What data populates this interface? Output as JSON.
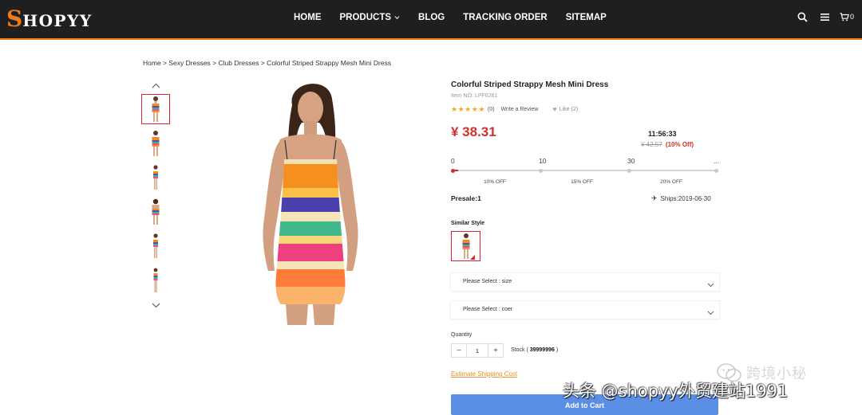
{
  "header": {
    "logo_first": "S",
    "logo_rest": "HOPYY",
    "nav": [
      {
        "label": "HOME"
      },
      {
        "label": "PRODUCTS",
        "has_caret": true
      },
      {
        "label": "BLOG"
      },
      {
        "label": "TRACKING ORDER"
      },
      {
        "label": "SITEMAP"
      }
    ],
    "icons": [
      "search-icon",
      "menu-icon",
      "cart-icon"
    ],
    "cart_count": "0",
    "accent_color": "#f07b1d",
    "bg_color": "#1f1f1f"
  },
  "breadcrumb": "Home > Sexy Dresses > Club Dresses > Colorful Striped Strappy Mesh Mini Dress",
  "gallery": {
    "thumb_count": 6,
    "active_index": 0,
    "icons": [
      "chevron-up-icon",
      "chevron-down-icon"
    ]
  },
  "product": {
    "title": "Colorful Striped Strappy Mesh Mini Dress",
    "item_no": "Item NO: LPF6261",
    "rating_stars": 5,
    "review_count": "(0)",
    "write_review": "Write a Review",
    "like_text": "Like (2)",
    "price": "¥ 38.31",
    "countdown": "11:56:33",
    "old_price": "¥ 42.57",
    "discount": "(10% Off)",
    "price_color": "#d0312d"
  },
  "tiers": {
    "quantities": [
      "0",
      "10",
      "30",
      "..."
    ],
    "offs": [
      "10% OFF",
      "15% OFF",
      "20% OFF"
    ],
    "active_tier": 0
  },
  "presale": "Presale:1",
  "ships": "Ships:2019-06-30",
  "similar_label": "Similar Style",
  "selects": {
    "size": "Please Select : size",
    "color": "Please Select : coer"
  },
  "quantity": {
    "label": "Quantity",
    "value": "1",
    "minus": "−",
    "plus": "+",
    "stock_prefix": "Stock ( ",
    "stock_value": "39999996",
    "stock_suffix": " )"
  },
  "estimate_shipping": "Estimate Shipping Cost",
  "add_to_cart": "Add to Cart",
  "add_to_cart_color": "#5b8fe6",
  "watermarks": {
    "wechat": "跨境小秘",
    "toutiao": "头条 @shopyy外贸建站1991"
  }
}
